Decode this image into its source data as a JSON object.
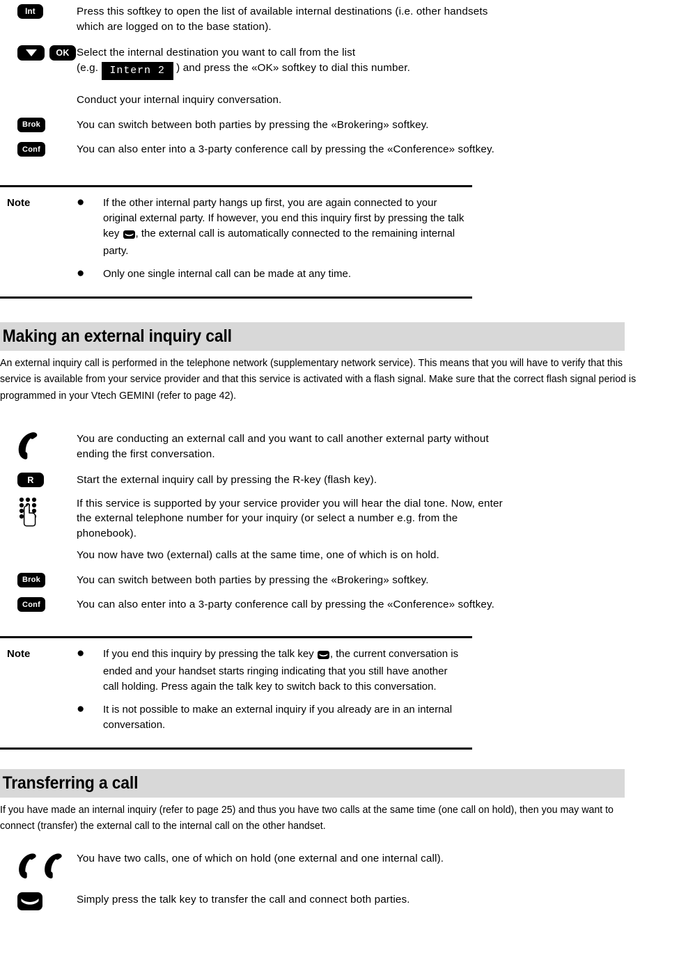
{
  "internal_section": {
    "steps": [
      {
        "keys": [
          "Int"
        ],
        "text": "Press this softkey to open the list of available internal destinations (i.e. other handsets which are logged on to the base station)."
      },
      {
        "keys": [
          "down-arrow",
          "OK"
        ],
        "text_before": "Select the internal destination you want to call from the list",
        "text_prefix": "(e.g.",
        "display_value": "Intern 2",
        "text_suffix": ") and press the «OK» softkey to dial this number."
      },
      {
        "keys": [],
        "text": "Conduct your internal inquiry conversation."
      },
      {
        "keys": [
          "Brok"
        ],
        "text": "You can switch between both parties by pressing the «Brokering» softkey."
      },
      {
        "keys": [
          "Conf"
        ],
        "text": "You can also enter into a 3-party conference call by pressing the «Conference» softkey."
      }
    ]
  },
  "note_internal": {
    "label": "Note",
    "bullet": "●",
    "items": [
      {
        "text_before": "If the other internal party hangs up first, you are again connected to your original external party. If however, you end this inquiry first by pressing the talk key",
        "inline_icon": "talk-key-icon",
        "text_after": ", the external call is automatically connected to the remaining internal party."
      },
      {
        "text_before": "Only one single internal call can be made at any time.",
        "inline_icon": null,
        "text_after": ""
      }
    ]
  },
  "external_section": {
    "heading": "Making an external inquiry call",
    "intro": "An external inquiry call is performed in the telephone network (supplementary network service). This means that you will have to verify that this service is available from your service provider and that this service is activated with a flash signal. Make sure that the correct flash signal period is programmed in your Vtech GEMINI (refer to page 42).",
    "steps": [
      {
        "icon": "handset-icon",
        "text": "You are conducting an external call and you want to call another external party without ending the first conversation."
      },
      {
        "icon": "key-R",
        "text": "Start the external inquiry call by pressing the R-key (flash key)."
      },
      {
        "icon": "keypad-hand-icon",
        "text": "If this service is supported by your service provider you will hear the dial tone. Now, enter the external telephone number for your inquiry (or select a number e.g. from the phonebook)."
      },
      {
        "icon": null,
        "text": "You now have two (external) calls at the same time, one of which is on hold."
      },
      {
        "icon": "key-Brok",
        "text": "You can switch between both parties by pressing the «Brokering» softkey."
      },
      {
        "icon": "key-Conf",
        "text": "You can also enter into a 3-party conference call by pressing the «Conference» softkey."
      }
    ]
  },
  "note_external": {
    "label": "Note",
    "bullet": "●",
    "items": [
      {
        "text_before": "If you end this inquiry by pressing the talk key",
        "inline_icon": "talk-key-icon",
        "text_after": ", the current conversation is ended and your handset starts ringing indicating that you still have another call holding. Press again the talk key to switch back to this conversation."
      },
      {
        "text_before": "It is not possible to make an external inquiry if you already are in an internal conversation.",
        "inline_icon": null,
        "text_after": ""
      }
    ]
  },
  "transfer_section": {
    "heading": "Transferring a call",
    "intro": "If you have made an internal inquiry (refer to page 25) and thus you have two calls at the same time (one call on hold), then you may want to connect (transfer) the external call to the internal call on the other handset.",
    "steps": [
      {
        "icon": "double-handset-icon",
        "text": "You have two calls, one of which on hold (one external and one internal call)."
      },
      {
        "icon": "talk-key-icon",
        "text": "Simply press the talk key to transfer the call and connect both parties."
      }
    ]
  },
  "keys": {
    "int": "Int",
    "ok": "OK",
    "brok": "Brok",
    "conf": "Conf",
    "r": "R"
  },
  "colors": {
    "heading_bar": "#d8d8d8",
    "key_background": "#000000",
    "key_text": "#ffffff"
  }
}
